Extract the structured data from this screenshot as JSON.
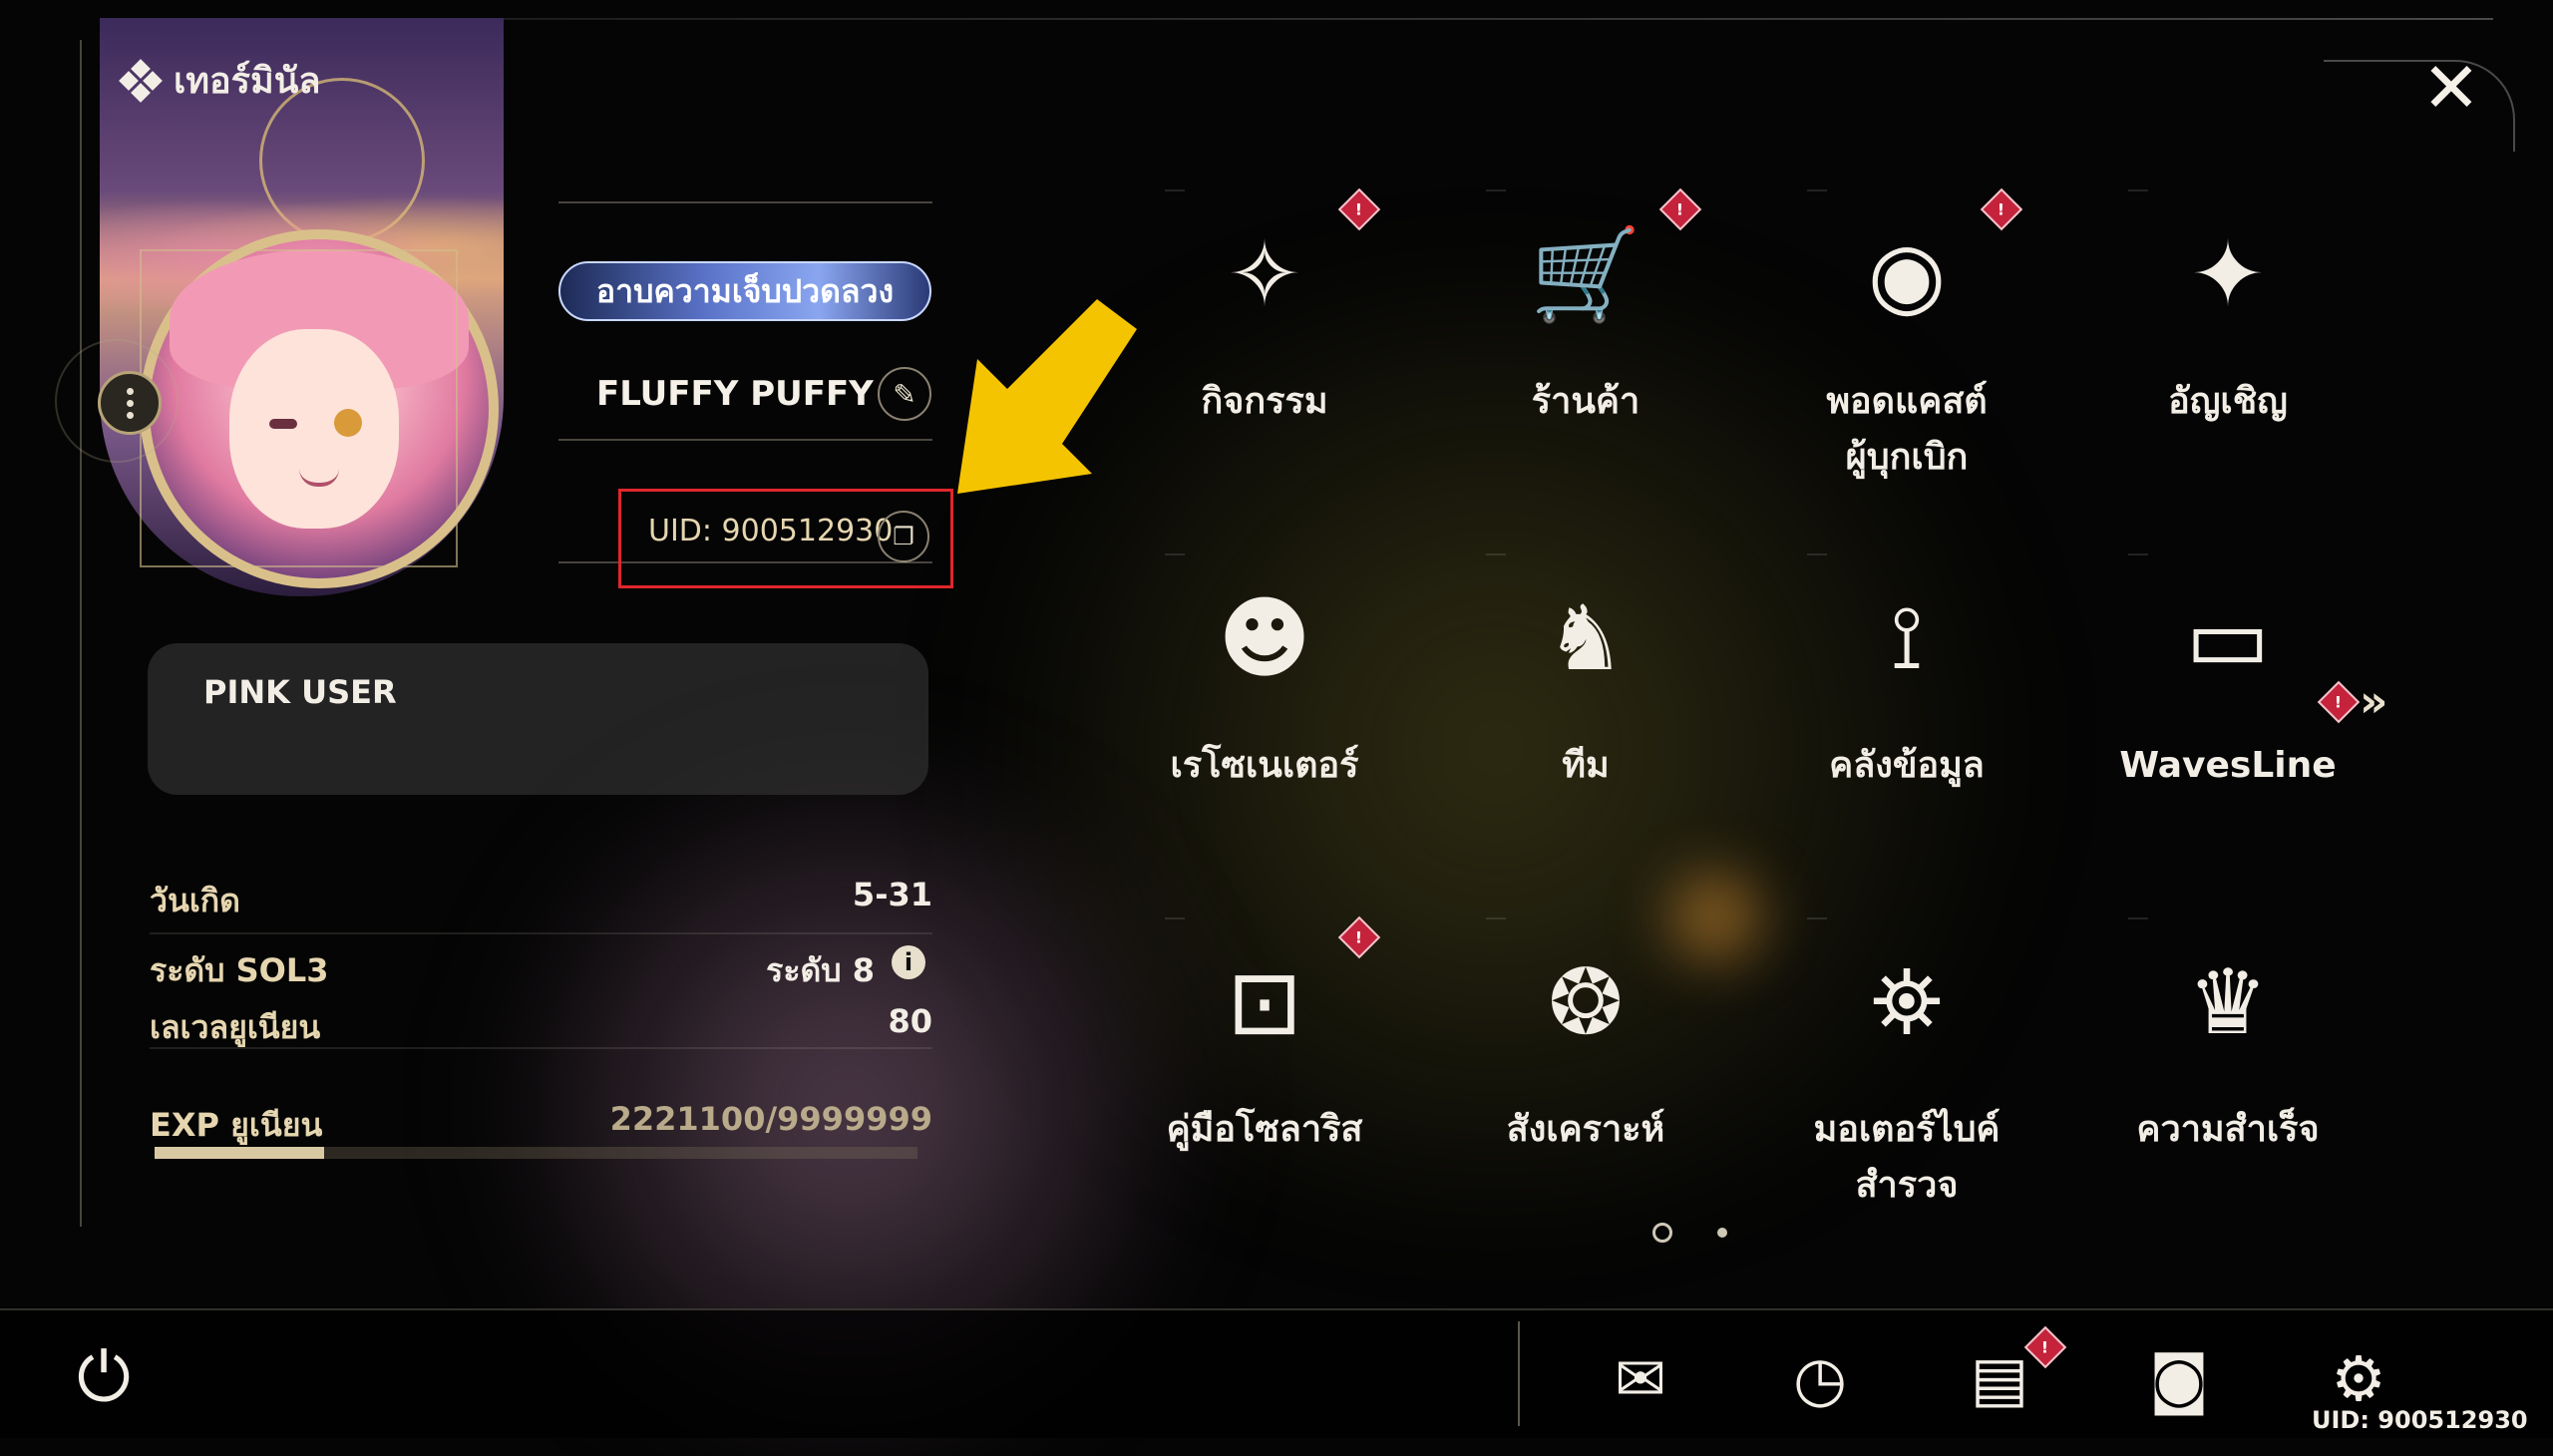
{
  "header": {
    "section_title": "เทอร์มินัล"
  },
  "profile": {
    "title_badge": "อาบความเจ็บปวดลวง",
    "username": "FLUFFY PUFFY",
    "uid": "UID: 900512930",
    "signature": "PINK USER"
  },
  "stats": {
    "birthday_label": "วันเกิด",
    "birthday_value": "5-31",
    "sol3_label": "ระดับ SOL3",
    "sol3_value": "ระดับ 8",
    "union_level_label": "เลเวลยูเนียน",
    "union_level_value": "80",
    "exp_label": "EXP ยูเนียน",
    "exp_value": "2221100/9999999",
    "exp_progress": 0.222
  },
  "features": [
    {
      "label": "กิจกรรม",
      "icon": "event-icon",
      "notification": true
    },
    {
      "label": "ร้านค้า",
      "icon": "shop-cart-icon",
      "notification": true
    },
    {
      "label": "พอดแคสต์\nผู้บุกเบิก",
      "icon": "podcast-icon",
      "notification": true
    },
    {
      "label": "อัญเชิญ",
      "icon": "convene-star-icon",
      "notification": false
    },
    {
      "label": "เรโซเนเตอร์",
      "icon": "resonator-head-icon",
      "notification": false
    },
    {
      "label": "ทีม",
      "icon": "team-chess-icon",
      "notification": false
    },
    {
      "label": "คลังข้อมูล",
      "icon": "data-bank-icon",
      "notification": false
    },
    {
      "label": "WavesLine",
      "icon": "chat-bubble-icon",
      "notification": false
    },
    {
      "label": "คู่มือโซลาริส",
      "icon": "guidebook-icon",
      "notification": true
    },
    {
      "label": "สังเคราะห์",
      "icon": "synthesis-icon",
      "notification": false
    },
    {
      "label": "มอเตอร์ไบค์\nสำรวจ",
      "icon": "motorbike-icon",
      "notification": false
    },
    {
      "label": "ความสำเร็จ",
      "icon": "achievement-trophy-icon",
      "notification": false
    }
  ],
  "pagination": {
    "current_page": 1,
    "total_pages": 2
  },
  "bottom_bar": {
    "uid_label": "UID: 900512930",
    "icons": [
      "mail-icon",
      "clock-icon",
      "notice-icon",
      "camera-icon",
      "settings-gear-icon"
    ],
    "notice_has_notification": true
  },
  "colors": {
    "accent_gold": "#d9c9a2",
    "notification_red": "#c4233b",
    "highlight_red": "#e0262c",
    "arrow_yellow": "#f5c400"
  }
}
